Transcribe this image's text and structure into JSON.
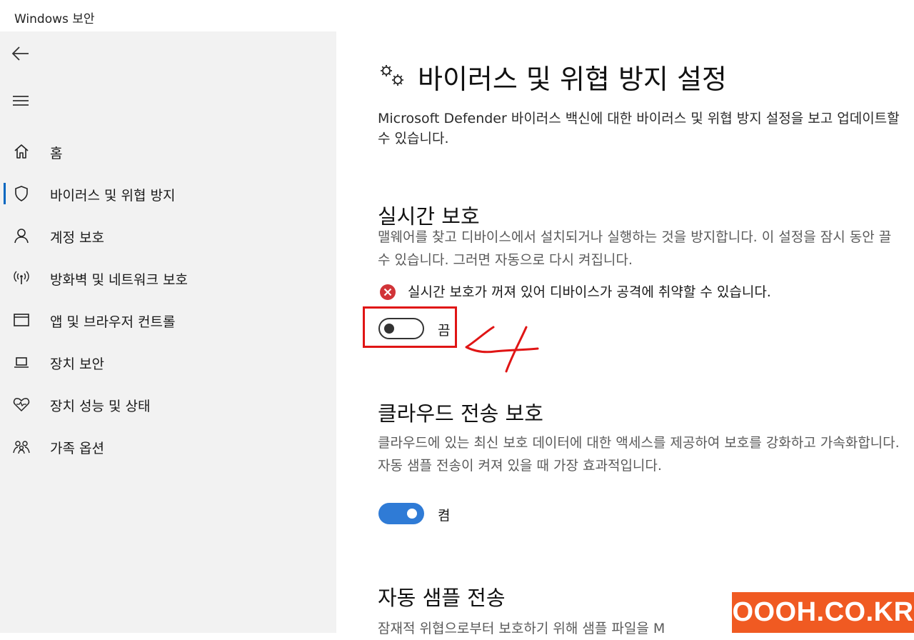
{
  "window": {
    "title": "Windows 보안"
  },
  "sidebar": {
    "items": [
      {
        "label": "홈",
        "icon": "home-icon"
      },
      {
        "label": "바이러스 및 위협 방지",
        "icon": "shield-icon",
        "selected": true
      },
      {
        "label": "계정 보호",
        "icon": "person-icon"
      },
      {
        "label": "방화벽 및 네트워크 보호",
        "icon": "wireless-icon"
      },
      {
        "label": "앱 및 브라우저 컨트롤",
        "icon": "browser-window-icon"
      },
      {
        "label": "장치 보안",
        "icon": "laptop-icon"
      },
      {
        "label": "장치 성능 및 상태",
        "icon": "heart-pulse-icon"
      },
      {
        "label": "가족 옵션",
        "icon": "family-icon"
      }
    ]
  },
  "main": {
    "title": "바이러스 및 위협 방지 설정",
    "description": "Microsoft Defender 바이러스 백신에 대한 바이러스 및 위협 방지 설정을 보고 업데이트할 수 있습니다.",
    "realtime": {
      "title": "실시간 보호",
      "description": "맬웨어를 찾고 디바이스에서 설치되거나 실행하는 것을 방지합니다. 이 설정을 잠시 동안 끌 수 있습니다. 그러면 자동으로 다시 켜집니다.",
      "warning": "실시간 보호가 꺼져 있어 디바이스가 공격에 취약할 수 있습니다.",
      "toggle_label": "끔",
      "toggle_on": false
    },
    "cloud": {
      "title": "클라우드 전송 보호",
      "description": "클라우드에 있는 최신 보호 데이터에 대한 액세스를 제공하여 보호를 강화하고 가속화합니다. 자동 샘플 전송이 켜져 있을 때 가장 효과적입니다.",
      "toggle_label": "켬",
      "toggle_on": true
    },
    "sample": {
      "title": "자동 샘플 전송",
      "description": "잠재적 위협으로부터 보호하기 위해 샘플 파일을 M"
    }
  },
  "annotation": {
    "step": "4"
  },
  "watermark": "OOOH.CO.KR",
  "colors": {
    "accent": "#0067c0",
    "toggle_on": "#2f7bd6",
    "error": "#d13438",
    "highlight": "#e01515",
    "watermark_bg": "#f05a22"
  }
}
